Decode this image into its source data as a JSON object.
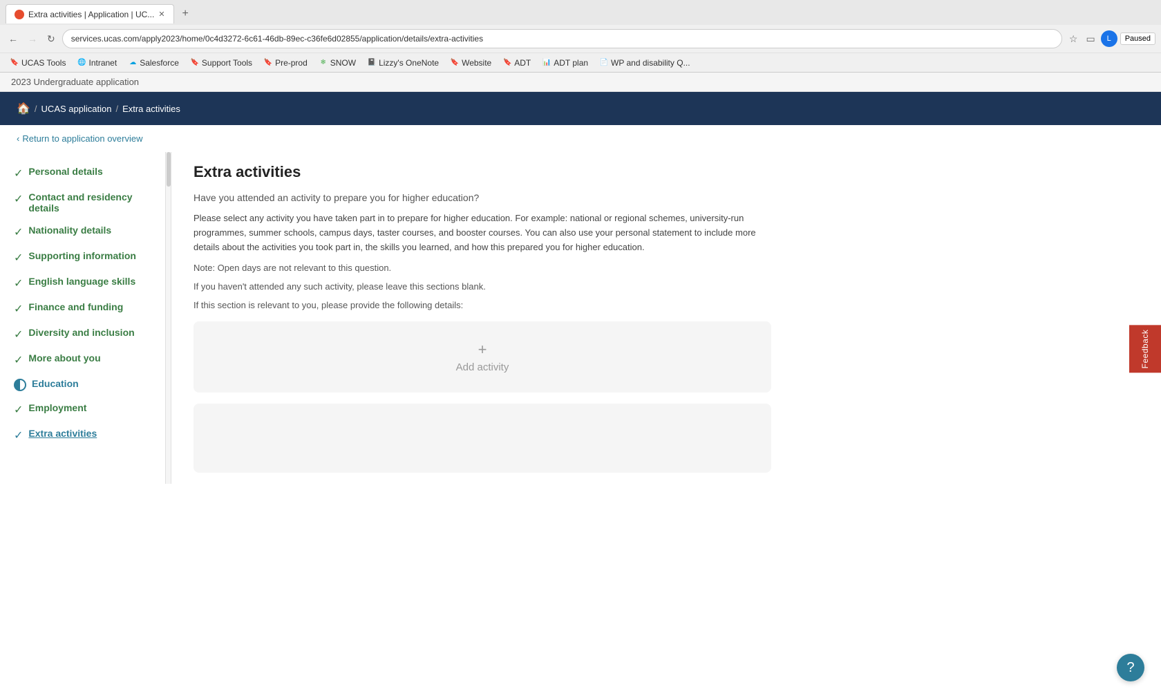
{
  "browser": {
    "tab_title": "Extra activities | Application | UC...",
    "tab_favicon_color": "#e64c2e",
    "url": "services.ucas.com/apply2023/home/0c4d3272-6c61-46db-89ec-c36fe6d02855/application/details/extra-activities",
    "new_tab_label": "+",
    "profile_initials": "L",
    "paused_label": "Paused",
    "bookmarks": [
      {
        "label": "UCAS Tools",
        "icon": "🔖",
        "icon_color": "#4CAF50"
      },
      {
        "label": "Intranet",
        "icon": "🌐",
        "icon_color": "#4CAF50"
      },
      {
        "label": "Salesforce",
        "icon": "☁",
        "icon_color": "#00A1E0"
      },
      {
        "label": "Support Tools",
        "icon": "🔖",
        "icon_color": "#FFA500"
      },
      {
        "label": "Pre-prod",
        "icon": "🔖",
        "icon_color": "#FFA500"
      },
      {
        "label": "SNOW",
        "icon": "❄",
        "icon_color": "#4CAF50"
      },
      {
        "label": "Lizzy's OneNote",
        "icon": "📓",
        "icon_color": "#7B2D8B"
      },
      {
        "label": "Website",
        "icon": "🔖",
        "icon_color": "#FFA500"
      },
      {
        "label": "ADT",
        "icon": "🔖",
        "icon_color": "#FFA500"
      },
      {
        "label": "ADT plan",
        "icon": "📊",
        "icon_color": "#4CAF50"
      },
      {
        "label": "WP and disability Q...",
        "icon": "📄",
        "icon_color": "#2196F3"
      }
    ]
  },
  "page_top": {
    "text": "2023 Undergraduate application"
  },
  "header": {
    "home_icon": "🏠",
    "breadcrumb_items": [
      {
        "label": "UCAS application",
        "link": true
      },
      {
        "label": "Extra activities",
        "link": false
      }
    ],
    "separator": "/"
  },
  "return_link": "Return to application overview",
  "sidebar": {
    "nav_items": [
      {
        "label": "Personal details",
        "state": "done"
      },
      {
        "label": "Contact and residency details",
        "state": "done"
      },
      {
        "label": "Nationality details",
        "state": "done"
      },
      {
        "label": "Supporting information",
        "state": "done"
      },
      {
        "label": "English language skills",
        "state": "done"
      },
      {
        "label": "Finance and funding",
        "state": "done"
      },
      {
        "label": "Diversity and inclusion",
        "state": "done"
      },
      {
        "label": "More about you",
        "state": "done"
      },
      {
        "label": "Education",
        "state": "partial"
      },
      {
        "label": "Employment",
        "state": "done"
      },
      {
        "label": "Extra activities",
        "state": "active"
      }
    ]
  },
  "main": {
    "page_title": "Extra activities",
    "question": "Have you attended an activity to prepare you for higher education?",
    "description": "Please select any activity you have taken part in to prepare for higher education. For example: national or regional schemes, university-run programmes, summer schools, campus days, taster courses, and booster courses. You can also use your personal statement to include more details about the activities you took part in, the skills you learned, and how this prepared you for higher education.",
    "note": "Note: Open days are not relevant to this question.",
    "if_not_attended": "If you haven't attended any such activity, please leave this sections blank.",
    "if_relevant": "If this section is relevant to you, please provide the following details:",
    "add_activity_plus": "+",
    "add_activity_label": "Add activity"
  },
  "feedback_label": "Feedback",
  "help_icon": "?"
}
